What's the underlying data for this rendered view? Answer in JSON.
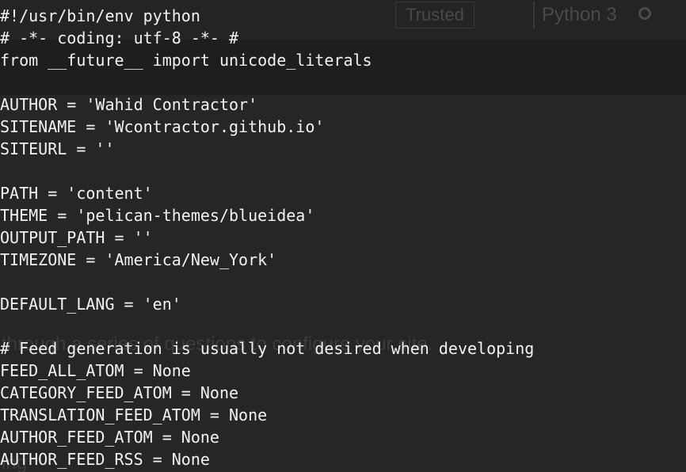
{
  "background": {
    "trusted_label": "Trusted",
    "kernel_label": "Python 3",
    "faint_text": "through a series of questions to configure your site.",
    "faint_text_2": "ing"
  },
  "editor": {
    "lines": [
      "#!/usr/bin/env python",
      "# -*- coding: utf-8 -*- #",
      "from __future__ import unicode_literals",
      "",
      "AUTHOR = 'Wahid Contractor'",
      "SITENAME = 'Wcontractor.github.io'",
      "SITEURL = ''",
      "",
      "PATH = 'content'",
      "THEME = 'pelican-themes/blueidea'",
      "OUTPUT_PATH = ''",
      "TIMEZONE = 'America/New_York'",
      "",
      "DEFAULT_LANG = 'en'",
      "",
      "# Feed generation is usually not desired when developing",
      "FEED_ALL_ATOM = None",
      "CATEGORY_FEED_ATOM = None",
      "TRANSLATION_FEED_ATOM = None",
      "AUTHOR_FEED_ATOM = None",
      "AUTHOR_FEED_RSS = None"
    ]
  }
}
